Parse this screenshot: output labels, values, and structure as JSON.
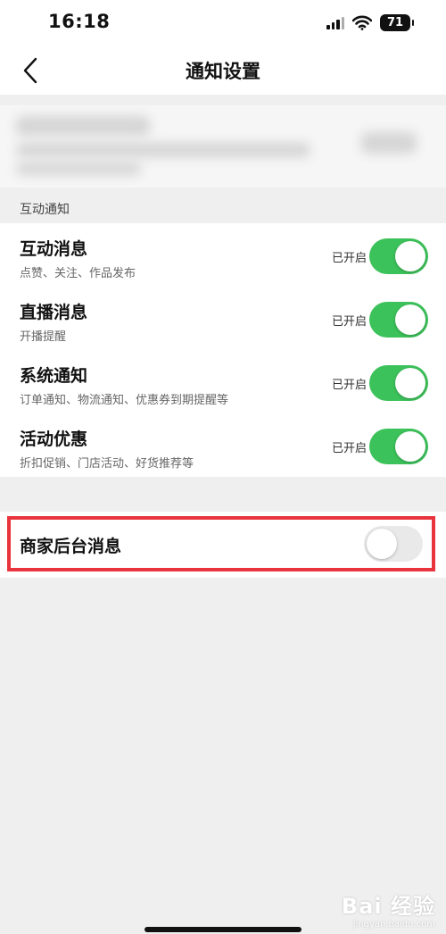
{
  "status_bar": {
    "time": "16:18",
    "battery": "71"
  },
  "nav": {
    "title": "通知设置",
    "back_icon": "chevron-left-icon"
  },
  "section": {
    "header": "互动通知"
  },
  "items": [
    {
      "title": "互动消息",
      "subtitle": "点赞、关注、作品发布",
      "status": "已开启",
      "enabled": true
    },
    {
      "title": "直播消息",
      "subtitle": "开播提醒",
      "status": "已开启",
      "enabled": true
    },
    {
      "title": "系统通知",
      "subtitle": "订单通知、物流通知、优惠券到期提醒等",
      "status": "已开启",
      "enabled": true
    },
    {
      "title": "活动优惠",
      "subtitle": "折扣促销、门店活动、好货推荐等",
      "status": "已开启",
      "enabled": true
    }
  ],
  "merchant": {
    "title": "商家后台消息",
    "enabled": false
  },
  "watermark": {
    "main": "Bai 经验",
    "sub": "jingyan.baidu.com"
  },
  "colors": {
    "toggle_on": "#3cc25a",
    "toggle_off": "#e9e9ea",
    "highlight": "#e8353d",
    "background": "#efefef"
  }
}
